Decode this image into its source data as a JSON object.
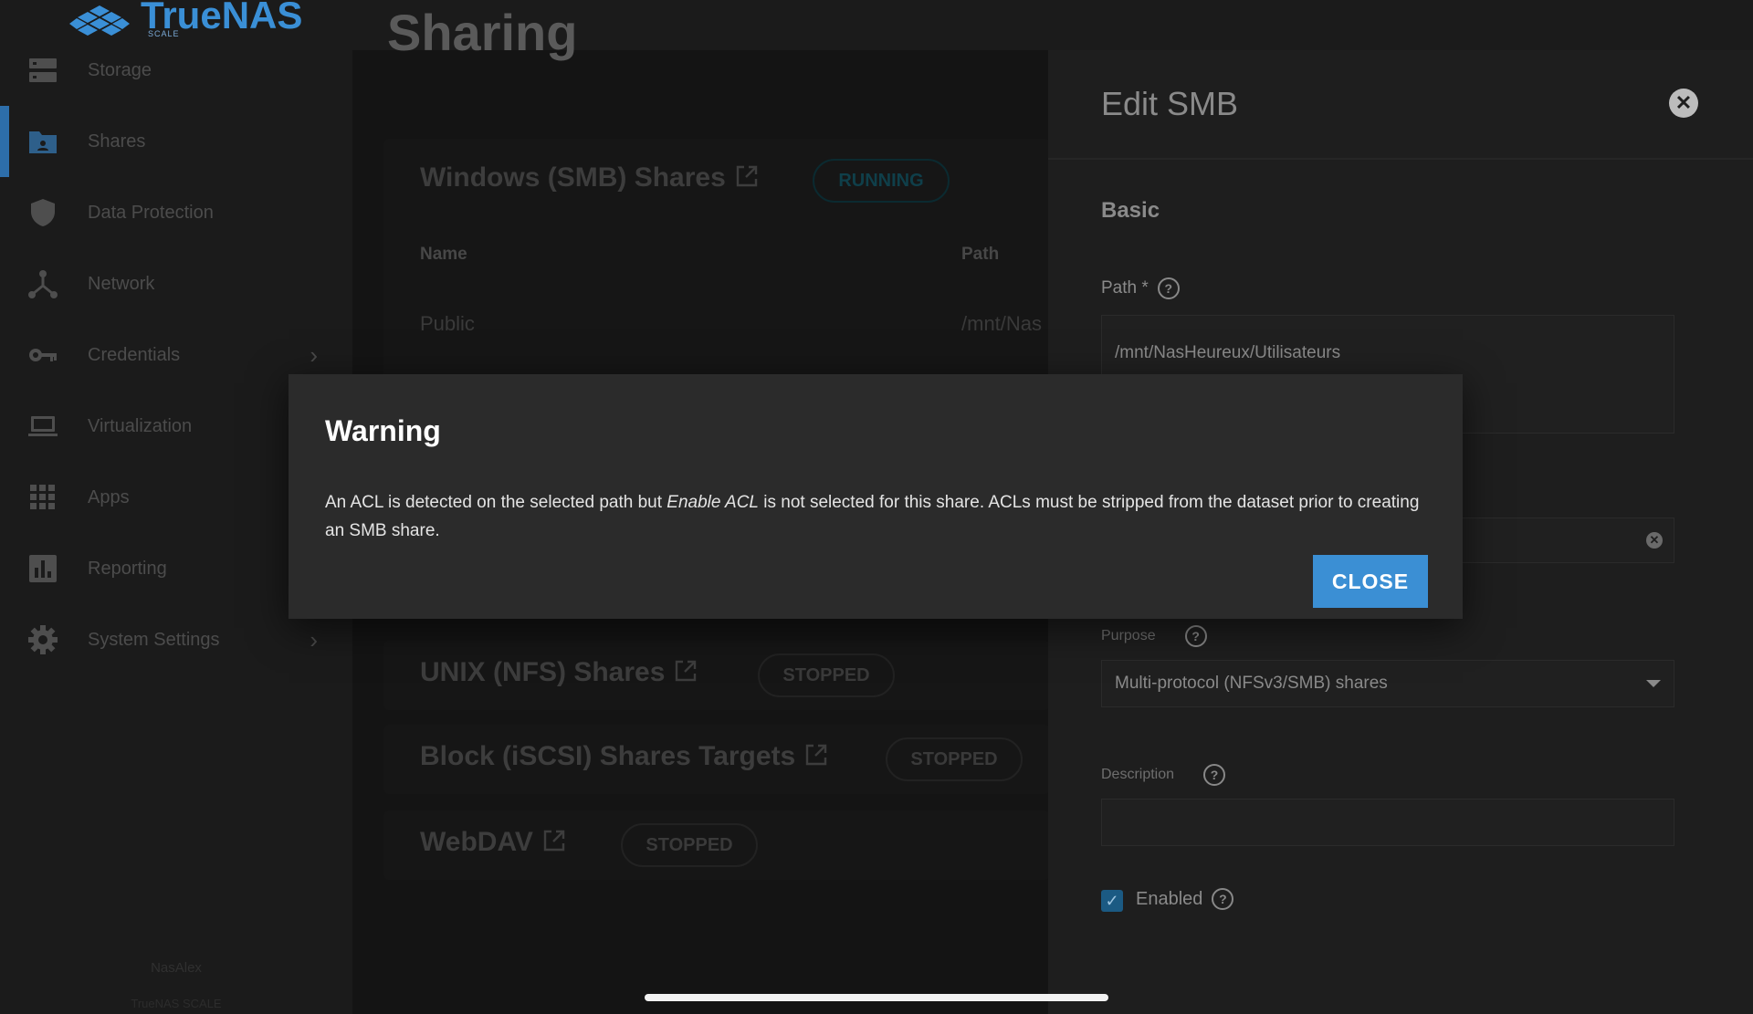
{
  "app": {
    "logo_text": "TrueNAS",
    "logo_sub": "SCALE"
  },
  "sidebar": {
    "items": [
      {
        "label": "Storage",
        "icon": "storage-icon"
      },
      {
        "label": "Shares",
        "icon": "shares-icon",
        "active": true
      },
      {
        "label": "Data Protection",
        "icon": "shield-icon"
      },
      {
        "label": "Network",
        "icon": "network-icon"
      },
      {
        "label": "Credentials",
        "icon": "key-icon",
        "has_submenu": true
      },
      {
        "label": "Virtualization",
        "icon": "laptop-icon"
      },
      {
        "label": "Apps",
        "icon": "apps-grid-icon"
      },
      {
        "label": "Reporting",
        "icon": "bar-chart-icon"
      },
      {
        "label": "System Settings",
        "icon": "gear-icon",
        "has_submenu": true
      }
    ],
    "footer_host": "NasAlex",
    "footer_sub": "TrueNAS SCALE"
  },
  "page": {
    "title": "Sharing"
  },
  "cards": {
    "smb": {
      "title": "Windows (SMB) Shares",
      "status": "RUNNING",
      "columns": [
        "Name",
        "Path"
      ],
      "rows": [
        {
          "name": "Public",
          "path": "/mnt/Nas"
        }
      ]
    },
    "nfs": {
      "title": "UNIX (NFS) Shares",
      "status": "STOPPED"
    },
    "iscsi": {
      "title": "Block (iSCSI) Shares Targets",
      "status": "STOPPED"
    },
    "webdav": {
      "title": "WebDAV",
      "status": "STOPPED"
    }
  },
  "panel": {
    "title": "Edit SMB",
    "section": "Basic",
    "path_label": "Path *",
    "path_value": "/mnt/NasHeureux/Utilisateurs",
    "purpose_label": "Purpose",
    "purpose_value": "Multi-protocol (NFSv3/SMB) shares",
    "description_label": "Description",
    "description_value": "",
    "enabled_label": "Enabled",
    "enabled": true
  },
  "dialog": {
    "title": "Warning",
    "message_before": "An ACL is detected on the selected path but ",
    "message_em": "Enable ACL",
    "message_after": " is not selected for this share. ACLs must be stripped from the dataset prior to creating an SMB share.",
    "close_label": "CLOSE"
  },
  "colors": {
    "accent": "#3b8fd4",
    "brand": "#3a8fd6",
    "active_nav": "#2d6eaa"
  }
}
